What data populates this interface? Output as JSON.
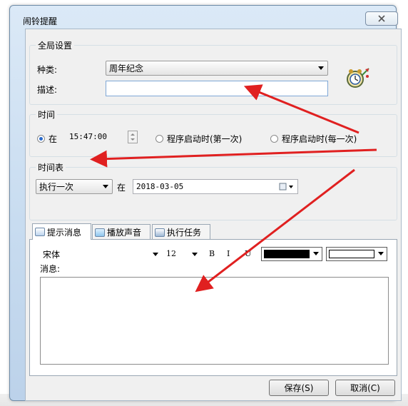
{
  "window": {
    "title": "闹铃提醒"
  },
  "global_settings": {
    "group_title": "全局设置",
    "type_label": "种类:",
    "type_value": "周年纪念",
    "desc_label": "描述:",
    "desc_value": ""
  },
  "time": {
    "group_title": "时间",
    "at_label": "在",
    "time_value": "15:47:00",
    "option_first_start": "程序启动时(第一次)",
    "option_each_start": "程序启动时(每一次)"
  },
  "schedule": {
    "group_title": "时间表",
    "frequency_value": "执行一次",
    "at_label": "在",
    "date_value": "2018-03-05"
  },
  "tabs": [
    {
      "label": "提示消息"
    },
    {
      "label": "播放声音"
    },
    {
      "label": "执行任务"
    }
  ],
  "message": {
    "font_name": "宋体",
    "font_size": "12",
    "bold": "B",
    "italic": "I",
    "underline": "U",
    "label": "消息:",
    "text_color": "#000000",
    "bg_color": "#ffffff",
    "body": ""
  },
  "buttons": {
    "save": "保存(S)",
    "cancel": "取消(C)"
  },
  "annotation_color": "#e02020"
}
